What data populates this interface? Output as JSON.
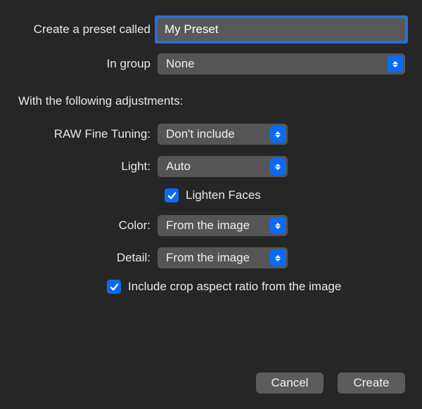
{
  "presetName": {
    "label": "Create a preset called",
    "value": "My Preset"
  },
  "group": {
    "label": "In group",
    "value": "None"
  },
  "sectionHeader": "With the following adjustments:",
  "adjustments": {
    "rawFineTuning": {
      "label": "RAW Fine Tuning:",
      "value": "Don't include"
    },
    "light": {
      "label": "Light:",
      "value": "Auto"
    },
    "lightenFaces": {
      "label": "Lighten Faces",
      "checked": true
    },
    "color": {
      "label": "Color:",
      "value": "From the image"
    },
    "detail": {
      "label": "Detail:",
      "value": "From the image"
    },
    "includeCrop": {
      "label": "Include crop aspect ratio from the image",
      "checked": true
    }
  },
  "buttons": {
    "cancel": "Cancel",
    "create": "Create"
  }
}
